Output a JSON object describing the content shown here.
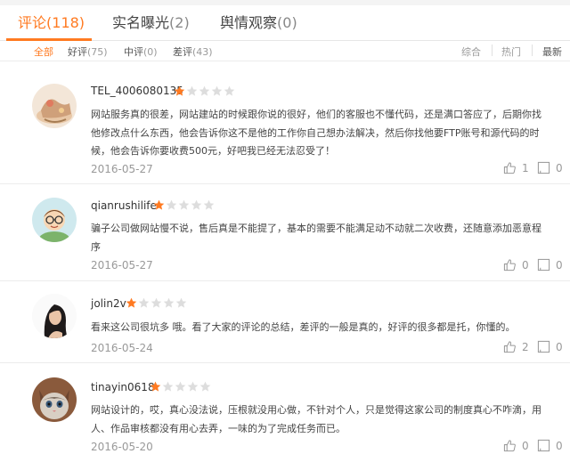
{
  "tabs": [
    {
      "label": "评论",
      "count": "(118)"
    },
    {
      "label": "实名曝光",
      "count": "(2)"
    },
    {
      "label": "舆情观察",
      "count": "(0)"
    }
  ],
  "filters": {
    "all": "全部",
    "good": {
      "label": "好评",
      "count": "(75)"
    },
    "medium": {
      "label": "中评",
      "count": "(0)"
    },
    "bad": {
      "label": "差评",
      "count": "(43)"
    }
  },
  "sort": {
    "overall": "综合",
    "hot": "热门",
    "latest": "最新"
  },
  "accent_color": "#ff7a21",
  "comments": [
    {
      "username": "TEL_4006080135",
      "rating": 1,
      "max_rating": 5,
      "lines": [
        "网站服务真的很差，网站建站的时候跟你说的很好，他们的客服也不懂代码，还是满口答应了，后期你找",
        "他修改点什么东西，他会告诉你这不是他的工作你自己想办法解决，然后你找他要FTP账号和源代码的时",
        "候，他会告诉你要收费500元，好吧我已经无法忍受了！"
      ],
      "date": "2016-05-27",
      "likes": "1",
      "replies": "0"
    },
    {
      "username": "qianrushilife",
      "rating": 1,
      "max_rating": 5,
      "lines": [
        "骗子公司做网站慢不说，售后真是不能提了，基本的需要不能满足动不动就二次收费，还随意添加恶意程",
        "序"
      ],
      "date": "2016-05-27",
      "likes": "0",
      "replies": "0"
    },
    {
      "username": "jolin2v",
      "rating": 1,
      "max_rating": 5,
      "lines": [
        "看来这公司很坑多 哦。看了大家的评论的总结，差评的一般是真的，好评的很多都是托，你懂的。"
      ],
      "date": "2016-05-24",
      "likes": "2",
      "replies": "0"
    },
    {
      "username": "tinayin0618",
      "rating": 1,
      "max_rating": 5,
      "lines": [
        "网站设计的，哎，真心没法说，压根就没用心做，不针对个人，只是觉得这家公司的制度真心不咋滴，用",
        "人、作品审核都没有用心去弄，一味的为了完成任务而已。"
      ],
      "date": "2016-05-20",
      "likes": "0",
      "replies": "0"
    }
  ]
}
